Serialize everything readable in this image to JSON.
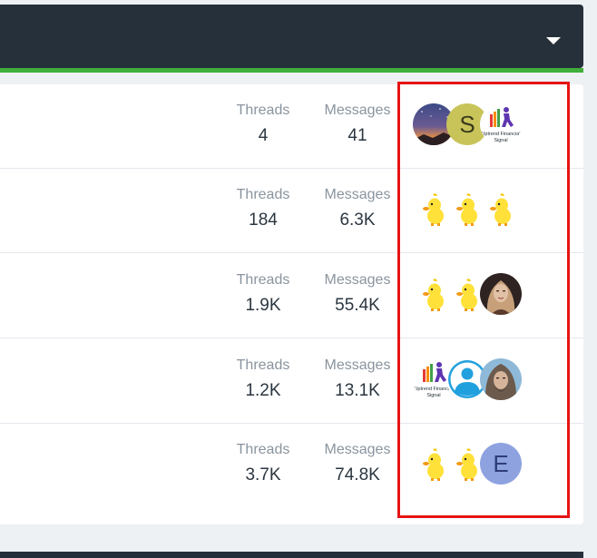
{
  "colors": {
    "header_bg": "#26303a",
    "accent_green": "#3fae3a",
    "highlight_box": "#e61414"
  },
  "header": {
    "dropdown_icon": "caret-down"
  },
  "labels": {
    "threads": "Threads",
    "messages": "Messages"
  },
  "forums": [
    {
      "threads": "4",
      "messages": "41",
      "avatars": [
        {
          "kind": "image",
          "icon": "night-sky-photo"
        },
        {
          "kind": "letter",
          "letter": "S",
          "bg": "#c9c45a",
          "fg": "#3a3a1a"
        },
        {
          "kind": "image",
          "icon": "uptrend-financial-signal-logo",
          "text": "Uptrend Financial Signal"
        }
      ]
    },
    {
      "threads": "184",
      "messages": "6.3K",
      "avatars": [
        {
          "kind": "image",
          "icon": "yellow-duck"
        },
        {
          "kind": "image",
          "icon": "yellow-duck"
        },
        {
          "kind": "image",
          "icon": "yellow-duck"
        }
      ]
    },
    {
      "threads": "1.9K",
      "messages": "55.4K",
      "avatars": [
        {
          "kind": "image",
          "icon": "yellow-duck"
        },
        {
          "kind": "image",
          "icon": "yellow-duck"
        },
        {
          "kind": "image",
          "icon": "woman-portrait-photo"
        }
      ]
    },
    {
      "threads": "1.2K",
      "messages": "13.1K",
      "avatars": [
        {
          "kind": "image",
          "icon": "uptrend-financial-signal-logo",
          "text": "Uptrend Financial Signal"
        },
        {
          "kind": "image",
          "icon": "default-user-silhouette"
        },
        {
          "kind": "image",
          "icon": "hooded-figure-avatar"
        }
      ]
    },
    {
      "threads": "3.7K",
      "messages": "74.8K",
      "avatars": [
        {
          "kind": "image",
          "icon": "yellow-duck"
        },
        {
          "kind": "image",
          "icon": "yellow-duck"
        },
        {
          "kind": "letter",
          "letter": "E",
          "bg": "#8ea2e0",
          "fg": "#2e3d78"
        }
      ]
    }
  ]
}
